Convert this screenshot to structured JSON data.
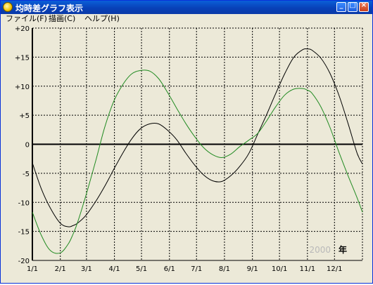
{
  "window": {
    "title": "均時差グラフ表示",
    "buttons": {
      "minimize": "_",
      "maximize": "□",
      "close": "×"
    }
  },
  "menu": [
    {
      "label": "ファイル(F)"
    },
    {
      "label": "描画(C)"
    },
    {
      "label": "ヘルプ(H)"
    }
  ],
  "year_label": "年",
  "year_value": "2000",
  "chart_data": {
    "type": "line",
    "title": "",
    "xlabel": "",
    "ylabel": "",
    "x_ticks": [
      "1/1",
      "2/1",
      "3/1",
      "4/1",
      "5/1",
      "6/1",
      "7/1",
      "8/1",
      "9/1",
      "10/1",
      "11/1",
      "12/1"
    ],
    "y_ticks": [
      "+20",
      "+15",
      "+10",
      "+5",
      "0",
      "-5",
      "-10",
      "-15",
      "-20"
    ],
    "ylim": [
      -20,
      20
    ],
    "x_unit": "day of year",
    "xlim": [
      0,
      366
    ],
    "grid": true,
    "series": [
      {
        "color": "#000000",
        "x": [
          0,
          10,
          20,
          31,
          40,
          45,
          50,
          59,
          70,
          80,
          90,
          100,
          110,
          120,
          130,
          140,
          150,
          160,
          170,
          180,
          190,
          200,
          210,
          220,
          230,
          240,
          250,
          260,
          270,
          280,
          290,
          300,
          305,
          310,
          320,
          330,
          340,
          350,
          360,
          366
        ],
        "y": [
          -3.2,
          -7.7,
          -11.0,
          -13.6,
          -14.2,
          -14.0,
          -13.6,
          -12.3,
          -9.9,
          -7.3,
          -4.4,
          -1.6,
          0.9,
          2.7,
          3.5,
          3.5,
          2.4,
          0.8,
          -1.5,
          -3.6,
          -5.3,
          -6.3,
          -6.4,
          -5.4,
          -3.8,
          -1.6,
          1.8,
          5.2,
          8.8,
          12.2,
          15.0,
          16.3,
          16.4,
          16.2,
          14.8,
          12.2,
          8.4,
          3.6,
          -1.5,
          -3.4
        ]
      },
      {
        "color": "#228b22",
        "x": [
          0,
          10,
          20,
          31,
          40,
          45,
          50,
          59,
          70,
          80,
          90,
          100,
          110,
          120,
          130,
          140,
          150,
          160,
          170,
          180,
          190,
          200,
          210,
          220,
          230,
          240,
          250,
          260,
          270,
          280,
          290,
          300,
          305,
          310,
          320,
          330,
          340,
          350,
          360,
          366
        ],
        "y": [
          -11.7,
          -15.7,
          -18.3,
          -18.7,
          -17.1,
          -15.5,
          -13.5,
          -9.0,
          -3.0,
          2.8,
          7.3,
          10.2,
          12.1,
          12.7,
          12.6,
          11.3,
          8.9,
          6.2,
          3.6,
          1.3,
          -0.6,
          -1.8,
          -2.3,
          -1.7,
          -0.4,
          0.7,
          1.9,
          4.1,
          6.5,
          8.5,
          9.5,
          9.6,
          9.3,
          8.8,
          6.4,
          2.9,
          -1.4,
          -5.4,
          -9.2,
          -11.7
        ]
      }
    ]
  }
}
